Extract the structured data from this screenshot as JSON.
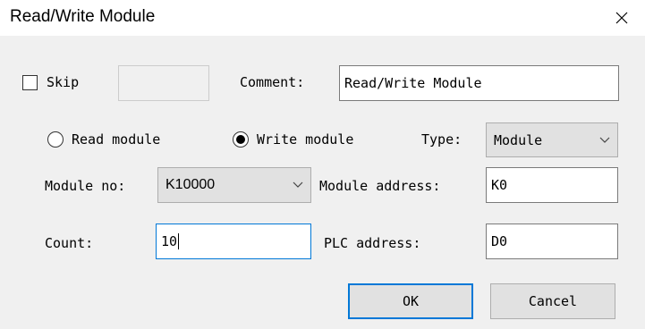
{
  "window": {
    "title": "Read/Write Module",
    "close_icon": "close-icon"
  },
  "skip": {
    "label": "Skip",
    "checked": false,
    "value": ""
  },
  "comment": {
    "label": "Comment:",
    "value": "Read/Write Module"
  },
  "mode": {
    "read_label": "Read module",
    "write_label": "Write module",
    "selected": "write"
  },
  "type": {
    "label": "Type:",
    "value": "Module"
  },
  "module_no": {
    "label": "Module no:",
    "value": "K10000"
  },
  "module_address": {
    "label": "Module address:",
    "value": "K0"
  },
  "count": {
    "label": "Count:",
    "value": "10"
  },
  "plc_address": {
    "label": "PLC address:",
    "value": "D0"
  },
  "buttons": {
    "ok": "OK",
    "cancel": "Cancel"
  },
  "colors": {
    "focus_border": "#0078d7",
    "dialog_bg": "#f0f0f0"
  }
}
